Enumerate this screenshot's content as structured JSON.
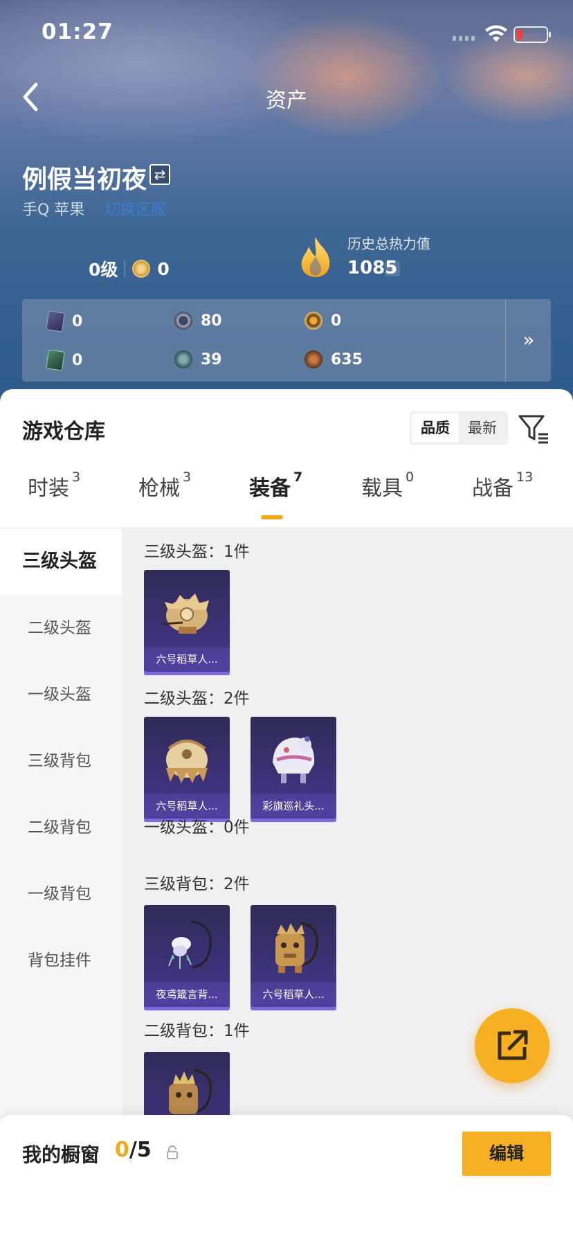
{
  "status": {
    "time": "01:27"
  },
  "nav": {
    "title": "资产"
  },
  "profile": {
    "name": "例假当初夜",
    "switch_glyph": "⇄",
    "account": "手Q 苹果",
    "account_link": "切换区服",
    "level": "0级",
    "rank_points": "0",
    "heat_label": "历史总热力值",
    "heat_value": "1085",
    "heat_help": "?"
  },
  "currencies": [
    {
      "icon": "card-purple-icon",
      "value": "0"
    },
    {
      "icon": "coin-dark-icon",
      "value": "80"
    },
    {
      "icon": "coin-gold-icon",
      "value": "0"
    },
    {
      "icon": "card-green-icon",
      "value": "0"
    },
    {
      "icon": "coin-teal-icon",
      "value": "39"
    },
    {
      "icon": "coin-bronze-icon",
      "value": "635"
    }
  ],
  "currency_more": "»",
  "warehouse": {
    "title": "游戏仓库",
    "sort_options": [
      "品质",
      "最新"
    ],
    "sort_selected": "品质"
  },
  "tabs": [
    {
      "label": "时装",
      "count": "3"
    },
    {
      "label": "枪械",
      "count": "3"
    },
    {
      "label": "装备",
      "count": "7",
      "active": true
    },
    {
      "label": "载具",
      "count": "0"
    },
    {
      "label": "战备",
      "count": "13"
    }
  ],
  "categories": [
    "三级头盔",
    "二级头盔",
    "一级头盔",
    "三级背包",
    "二级背包",
    "一级背包",
    "背包挂件"
  ],
  "sections": [
    {
      "label": "三级头盔：1件",
      "items": [
        "六号稻草人..."
      ]
    },
    {
      "label": "二级头盔：2件",
      "items": [
        "六号稻草人...",
        "彩旗巡礼头..."
      ]
    },
    {
      "label": "一级头盔：0件",
      "items": []
    },
    {
      "label": "三级背包：2件",
      "items": [
        "夜鸢箴言背...",
        "六号稻草人..."
      ]
    },
    {
      "label": "二级背包：1件",
      "items": [
        ""
      ]
    }
  ],
  "showcase": {
    "title": "我的橱窗",
    "current": "0",
    "total": "/5",
    "edit_label": "编辑"
  },
  "colors": {
    "accent": "#f7b021",
    "card_bg": "#3d3278",
    "link": "#3a8cff"
  }
}
